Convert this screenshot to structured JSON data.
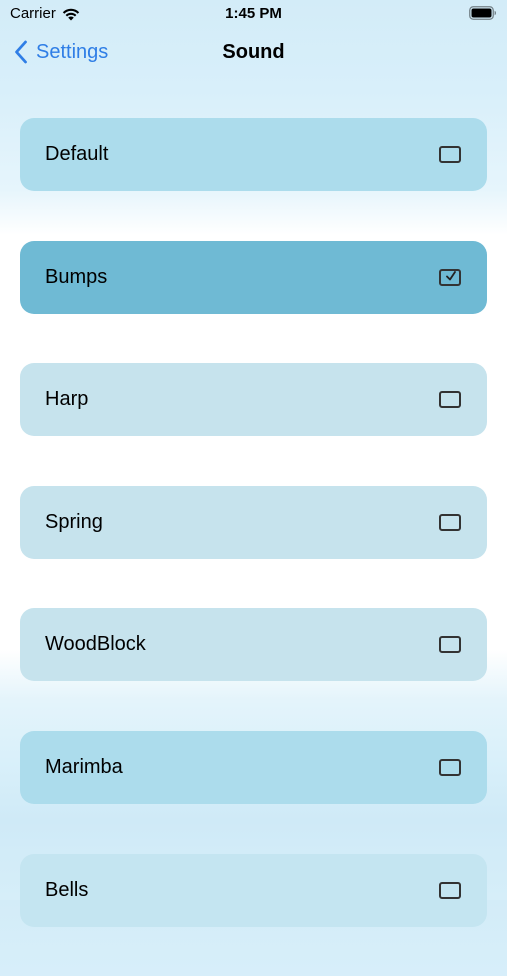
{
  "status_bar": {
    "carrier": "Carrier",
    "time": "1:45 PM"
  },
  "nav": {
    "back_label": "Settings",
    "title": "Sound"
  },
  "options": [
    {
      "label": "Default",
      "checked": false,
      "color": "#acdcec"
    },
    {
      "label": "Bumps",
      "checked": true,
      "color": "#6fbad4"
    },
    {
      "label": "Harp",
      "checked": false,
      "color": "#c6e3ed"
    },
    {
      "label": "Spring",
      "checked": false,
      "color": "#c6e3ed"
    },
    {
      "label": "WoodBlock",
      "checked": false,
      "color": "#c6e3ed"
    },
    {
      "label": "Marimba",
      "checked": false,
      "color": "#acdcec"
    },
    {
      "label": "Bells",
      "checked": false,
      "color": "#c4e5f1"
    }
  ],
  "colors": {
    "accent": "#2f7ee6"
  }
}
